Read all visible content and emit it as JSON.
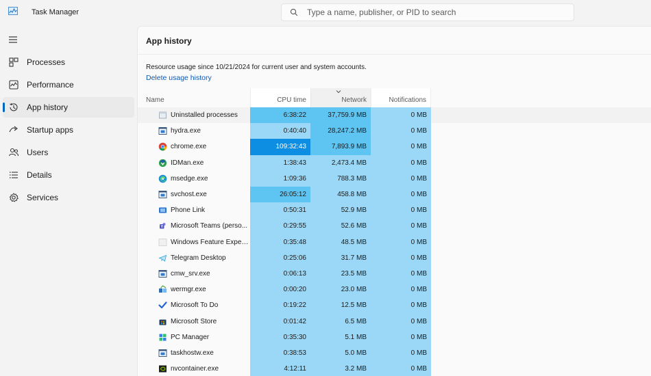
{
  "app": {
    "title": "Task Manager"
  },
  "search": {
    "placeholder": "Type a name, publisher, or PID to search"
  },
  "sidebar": {
    "items": [
      {
        "label": "Processes",
        "icon": "processes-icon",
        "active": false
      },
      {
        "label": "Performance",
        "icon": "performance-icon",
        "active": false
      },
      {
        "label": "App history",
        "icon": "history-icon",
        "active": true
      },
      {
        "label": "Startup apps",
        "icon": "startup-icon",
        "active": false
      },
      {
        "label": "Users",
        "icon": "users-icon",
        "active": false
      },
      {
        "label": "Details",
        "icon": "details-icon",
        "active": false
      },
      {
        "label": "Services",
        "icon": "services-icon",
        "active": false
      }
    ]
  },
  "main": {
    "title": "App history",
    "usage_text": "Resource usage since 10/21/2024 for current user and system accounts.",
    "delete_link": "Delete usage history",
    "columns": {
      "name": "Name",
      "cpu": "CPU time",
      "network": "Network",
      "notifications": "Notifications"
    },
    "sorted_column": "network",
    "rows": [
      {
        "name": "Uninstalled processes",
        "icon": "uninstalled-icon",
        "cpu": "6:38:22",
        "network": "37,759.9 MB",
        "notifications": "0 MB",
        "cpu_level": 2,
        "net_level": 2
      },
      {
        "name": "hydra.exe",
        "icon": "exe-icon",
        "cpu": "0:40:40",
        "network": "28,247.2 MB",
        "notifications": "0 MB",
        "cpu_level": 1,
        "net_level": 2
      },
      {
        "name": "chrome.exe",
        "icon": "chrome-icon",
        "cpu": "109:32:43",
        "network": "7,893.9 MB",
        "notifications": "0 MB",
        "cpu_level": 3,
        "net_level": 2
      },
      {
        "name": "IDMan.exe",
        "icon": "idman-icon",
        "cpu": "1:38:43",
        "network": "2,473.4 MB",
        "notifications": "0 MB",
        "cpu_level": 1,
        "net_level": 1
      },
      {
        "name": "msedge.exe",
        "icon": "edge-icon",
        "cpu": "1:09:36",
        "network": "788.3 MB",
        "notifications": "0 MB",
        "cpu_level": 1,
        "net_level": 1
      },
      {
        "name": "svchost.exe",
        "icon": "exe-icon",
        "cpu": "26:05:12",
        "network": "458.8 MB",
        "notifications": "0 MB",
        "cpu_level": 2,
        "net_level": 1
      },
      {
        "name": "Phone Link",
        "icon": "phone-link-icon",
        "cpu": "0:50:31",
        "network": "52.9 MB",
        "notifications": "0 MB",
        "cpu_level": 1,
        "net_level": 1
      },
      {
        "name": "Microsoft Teams (perso...",
        "icon": "teams-icon",
        "cpu": "0:29:55",
        "network": "52.6 MB",
        "notifications": "0 MB",
        "cpu_level": 1,
        "net_level": 1
      },
      {
        "name": "Windows Feature Exper...",
        "icon": "blank-app-icon",
        "cpu": "0:35:48",
        "network": "48.5 MB",
        "notifications": "0 MB",
        "cpu_level": 1,
        "net_level": 1
      },
      {
        "name": "Telegram Desktop",
        "icon": "telegram-icon",
        "cpu": "0:25:06",
        "network": "31.7 MB",
        "notifications": "0 MB",
        "cpu_level": 1,
        "net_level": 1
      },
      {
        "name": "cmw_srv.exe",
        "icon": "exe-icon",
        "cpu": "0:06:13",
        "network": "23.5 MB",
        "notifications": "0 MB",
        "cpu_level": 1,
        "net_level": 1
      },
      {
        "name": "wermgr.exe",
        "icon": "wermgr-icon",
        "cpu": "0:00:20",
        "network": "23.0 MB",
        "notifications": "0 MB",
        "cpu_level": 1,
        "net_level": 1
      },
      {
        "name": "Microsoft To Do",
        "icon": "todo-icon",
        "cpu": "0:19:22",
        "network": "12.5 MB",
        "notifications": "0 MB",
        "cpu_level": 1,
        "net_level": 1
      },
      {
        "name": "Microsoft Store",
        "icon": "store-icon",
        "cpu": "0:01:42",
        "network": "6.5 MB",
        "notifications": "0 MB",
        "cpu_level": 1,
        "net_level": 1
      },
      {
        "name": "PC Manager",
        "icon": "pc-manager-icon",
        "cpu": "0:35:30",
        "network": "5.1 MB",
        "notifications": "0 MB",
        "cpu_level": 1,
        "net_level": 1
      },
      {
        "name": "taskhostw.exe",
        "icon": "exe-icon",
        "cpu": "0:38:53",
        "network": "5.0 MB",
        "notifications": "0 MB",
        "cpu_level": 1,
        "net_level": 1
      },
      {
        "name": "nvcontainer.exe",
        "icon": "nvidia-icon",
        "cpu": "4:12:11",
        "network": "3.2 MB",
        "notifications": "0 MB",
        "cpu_level": 1,
        "net_level": 1
      }
    ]
  },
  "colors": {
    "heat_level_1": "#9bd8f7",
    "heat_level_2": "#5ec4f2",
    "heat_level_3": "#0d8ee3",
    "accent": "#0067c0",
    "link": "#0a58b8"
  }
}
